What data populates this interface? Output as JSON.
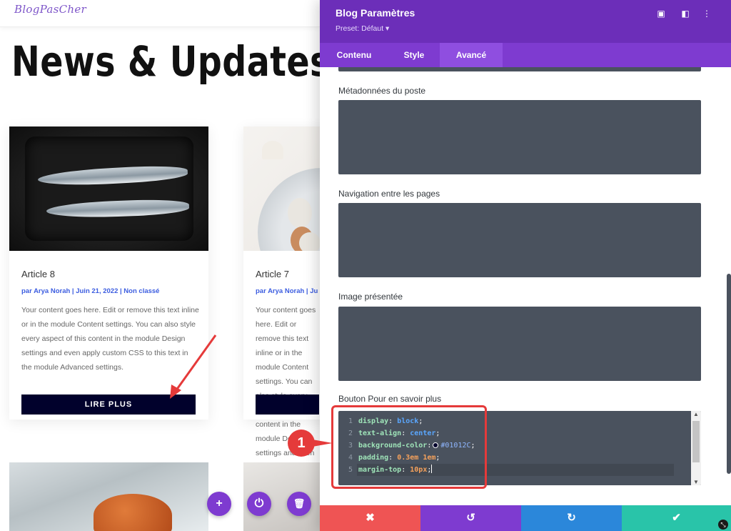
{
  "site": {
    "logo": "BlogPasCher",
    "title": "News & Updates"
  },
  "posts": [
    {
      "title": "Article 8",
      "meta": "par Arya Norah | Juin 21, 2022 | Non classé",
      "excerpt": "Your content goes here. Edit or remove this text inline or in the module Content settings. You can also style every aspect of this content in the module Design settings and even apply custom CSS to this text in the module Advanced settings.",
      "button": "LIRE PLUS"
    },
    {
      "title": "Article 7",
      "meta": "par Arya Norah | Ju",
      "excerpt": "Your content goes here. Edit or remove this text inline or in the module Content settings. You can also style every aspect of this content in the module Design settings and even apply custom CSS to this text in the module Advanced settings.",
      "button": ""
    }
  ],
  "builder_controls": {
    "add_icon": "plus-icon",
    "power_icon": "power-icon",
    "trash_icon": "trash-icon"
  },
  "panel": {
    "title": "Blog Paramètres",
    "preset": "Preset: Défaut ▾",
    "tabs": [
      "Contenu",
      "Style",
      "Avancé"
    ],
    "active_tab": "Avancé",
    "fields": [
      {
        "label": "Métadonnées du poste"
      },
      {
        "label": "Navigation entre les pages"
      },
      {
        "label": "Image présentée"
      },
      {
        "label": "Bouton Pour en savoir plus"
      }
    ],
    "css_code": [
      {
        "n": "1",
        "prop": "display",
        "value": "block"
      },
      {
        "n": "2",
        "prop": "text-align",
        "value": "center"
      },
      {
        "n": "3",
        "prop": "background-color",
        "value": "#01012C"
      },
      {
        "n": "4",
        "prop": "padding",
        "value": "0.3em 1em"
      },
      {
        "n": "5",
        "prop": "margin-top",
        "value": "10px"
      }
    ],
    "footer_buttons": [
      {
        "name": "cancel",
        "glyph": "✖",
        "color": "#ef5454"
      },
      {
        "name": "undo",
        "glyph": "↺",
        "color": "#7e3bd0"
      },
      {
        "name": "redo",
        "glyph": "↻",
        "color": "#2b87da"
      },
      {
        "name": "save",
        "glyph": "✔",
        "color": "#29c4a9"
      }
    ]
  },
  "annotation": {
    "callout_number": "1"
  },
  "colors": {
    "panel_header": "#6c2eb9",
    "tabs_bar": "#7e3bd0",
    "active_tab": "#8f4ee0",
    "field_bg": "#4a525e",
    "button_bg": "#01012c",
    "highlight": "#e53a3a"
  }
}
